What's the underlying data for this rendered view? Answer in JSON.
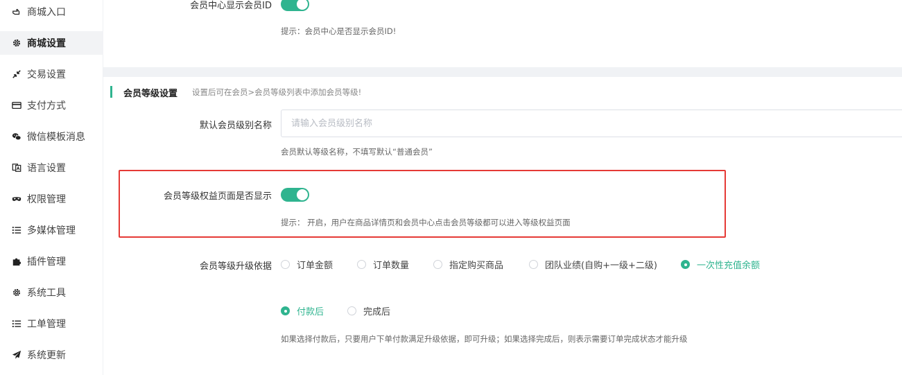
{
  "sidebar": {
    "items": [
      {
        "label": "商城入口",
        "icon": "hand-pointer-icon",
        "active": false
      },
      {
        "label": "商城设置",
        "icon": "gear-icon",
        "active": true
      },
      {
        "label": "交易设置",
        "icon": "compress-arrows-icon",
        "active": false
      },
      {
        "label": "支付方式",
        "icon": "credit-card-icon",
        "active": false
      },
      {
        "label": "微信模板消息",
        "icon": "wechat-icon",
        "active": false
      },
      {
        "label": "语言设置",
        "icon": "language-icon",
        "active": false
      },
      {
        "label": "权限管理",
        "icon": "mask-icon",
        "active": false
      },
      {
        "label": "多媒体管理",
        "icon": "list-icon",
        "active": false
      },
      {
        "label": "插件管理",
        "icon": "puzzle-icon",
        "active": false
      },
      {
        "label": "系统工具",
        "icon": "gear-icon",
        "active": false
      },
      {
        "label": "工单管理",
        "icon": "list-icon",
        "active": false
      },
      {
        "label": "系统更新",
        "icon": "paper-plane-icon",
        "active": false
      }
    ]
  },
  "member_id": {
    "label": "会员中心显示会员ID",
    "enabled": true,
    "hint": "提示：会员中心是否显示会员ID!"
  },
  "level_section": {
    "title": "会员等级设置",
    "subtitle": "设置后可在会员>会员等级列表中添加会员等级!",
    "default_name": {
      "label": "默认会员级别名称",
      "placeholder": "请输入会员级别名称",
      "value": "",
      "hint": "会员默认等级名称，不填写默认“普通会员”"
    },
    "rights_page": {
      "label": "会员等级权益页面是否显示",
      "enabled": true,
      "hint": "提示： 开启，用户在商品详情页和会员中心点击会员等级都可以进入等级权益页面"
    },
    "upgrade_basis": {
      "label": "会员等级升级依据",
      "options": [
        "订单金额",
        "订单数量",
        "指定购买商品",
        "团队业绩(自购+一级+二级)",
        "一次性充值余额"
      ],
      "selected": "一次性充值余额"
    },
    "upgrade_timing": {
      "options": [
        "付款后",
        "完成后"
      ],
      "selected": "付款后",
      "hint": "如果选择付款后，只要用户下单付款满足升级依据，即可升级；如果选择完成后，则表示需要订单完成状态才能升级"
    }
  },
  "colors": {
    "accent": "#2fb48f",
    "highlight_border": "#e53935",
    "band": "#f0f2f5"
  }
}
